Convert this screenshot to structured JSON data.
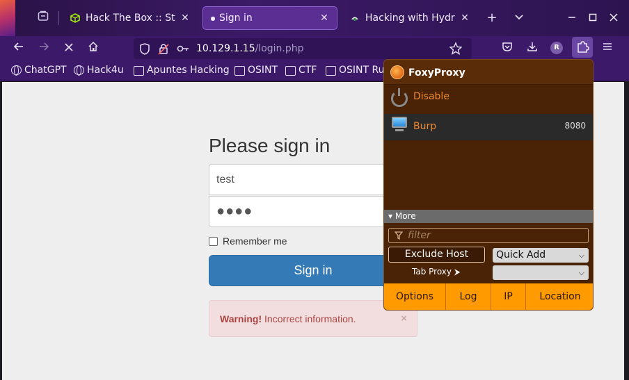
{
  "browser": {
    "tabs": [
      {
        "label": "Hack The Box :: Start",
        "icon": "htb-cube-icon",
        "active": false
      },
      {
        "label": "Sign in",
        "icon": "dot-icon",
        "active": true
      },
      {
        "label": "Hacking with Hydra -",
        "icon": "hydra-icon",
        "active": false
      }
    ],
    "new_tab_symbol": "+",
    "url_host": "10.129.1.15",
    "url_path": "/login.php",
    "profile_initial": "R",
    "accent_color": "#3c1a69"
  },
  "bookmarks": [
    {
      "label": "ChatGPT",
      "icon": "globe-icon"
    },
    {
      "label": "Hack4u",
      "icon": "globe-icon"
    },
    {
      "label": "Apuntes Hacking",
      "icon": "folder-icon"
    },
    {
      "label": "OSINT",
      "icon": "folder-icon"
    },
    {
      "label": "CTF",
      "icon": "folder-icon"
    },
    {
      "label": "OSINT Rus",
      "icon": "folder-icon"
    }
  ],
  "login": {
    "heading": "Please sign in",
    "username_value": "test",
    "password_value": "●●●●",
    "remember_label": "Remember me",
    "submit_label": "Sign in",
    "alert_strong": "Warning!",
    "alert_text": " Incorrect information.",
    "alert_close": "×"
  },
  "foxyproxy": {
    "title": "FoxyProxy",
    "disable_label": "Disable",
    "proxies": [
      {
        "name": "Burp",
        "port": "8080"
      }
    ],
    "more_label": "▾ More",
    "filter_placeholder": "filter",
    "exclude_host_label": "Exclude Host",
    "quick_add_label": "Quick Add",
    "tab_proxy_label": "Tab Proxy ⮞",
    "tab_proxy_value": "",
    "footer_buttons": [
      "Options",
      "Log",
      "IP",
      "Location"
    ],
    "footer_color": "#ff9a00"
  }
}
